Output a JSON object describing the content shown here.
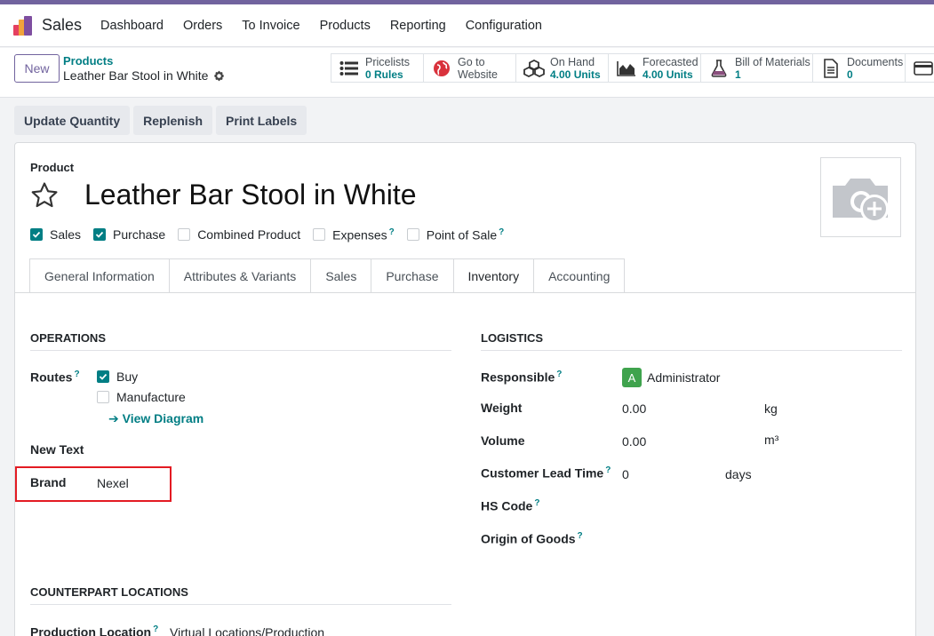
{
  "navbar": {
    "app_name": "Sales",
    "menu": [
      "Dashboard",
      "Orders",
      "To Invoice",
      "Products",
      "Reporting",
      "Configuration"
    ]
  },
  "control": {
    "new_label": "New",
    "breadcrumb_parent": "Products",
    "breadcrumb_current": "Leather Bar Stool in White"
  },
  "smart_buttons": {
    "pricelists": {
      "label": "Pricelists",
      "value": "0 Rules"
    },
    "website": {
      "label": "Go to",
      "value": "Website"
    },
    "onhand": {
      "label": "On Hand",
      "value": "4.00 Units"
    },
    "forecasted": {
      "label": "Forecasted",
      "value": "4.00 Units"
    },
    "bom": {
      "label": "Bill of Materials",
      "value": "1"
    },
    "documents": {
      "label": "Documents",
      "value": "0"
    }
  },
  "actions": {
    "update_qty": "Update Quantity",
    "replenish": "Replenish",
    "print_labels": "Print Labels"
  },
  "product": {
    "label": "Product",
    "title": "Leather Bar Stool in White",
    "checkboxes": {
      "sales": "Sales",
      "purchase": "Purchase",
      "combined": "Combined Product",
      "expenses": "Expenses",
      "pos": "Point of Sale"
    }
  },
  "tabs": {
    "general": "General Information",
    "attributes": "Attributes & Variants",
    "sales": "Sales",
    "purchase": "Purchase",
    "inventory": "Inventory",
    "accounting": "Accounting"
  },
  "operations": {
    "title": "OPERATIONS",
    "routes_label": "Routes",
    "route_buy": "Buy",
    "route_manufacture": "Manufacture",
    "view_diagram": "View Diagram",
    "new_text": "New Text",
    "brand_label": "Brand",
    "brand_value": "Nexel"
  },
  "logistics": {
    "title": "LOGISTICS",
    "responsible_label": "Responsible",
    "responsible_value": "Administrator",
    "responsible_initial": "A",
    "weight_label": "Weight",
    "weight_value": "0.00",
    "weight_unit": "kg",
    "volume_label": "Volume",
    "volume_value": "0.00",
    "volume_unit": "m³",
    "lead_time_label": "Customer Lead Time",
    "lead_time_value": "0",
    "lead_time_unit": "days",
    "hs_code_label": "HS Code",
    "origin_label": "Origin of Goods"
  },
  "counterpart": {
    "title": "COUNTERPART LOCATIONS",
    "production_label": "Production Location",
    "production_value": "Virtual Locations/Production"
  },
  "colors": {
    "brand_purple": "#71639e",
    "accent_teal": "#017e84",
    "highlight_red": "#e31b23",
    "avatar_green": "#3fa34d"
  }
}
